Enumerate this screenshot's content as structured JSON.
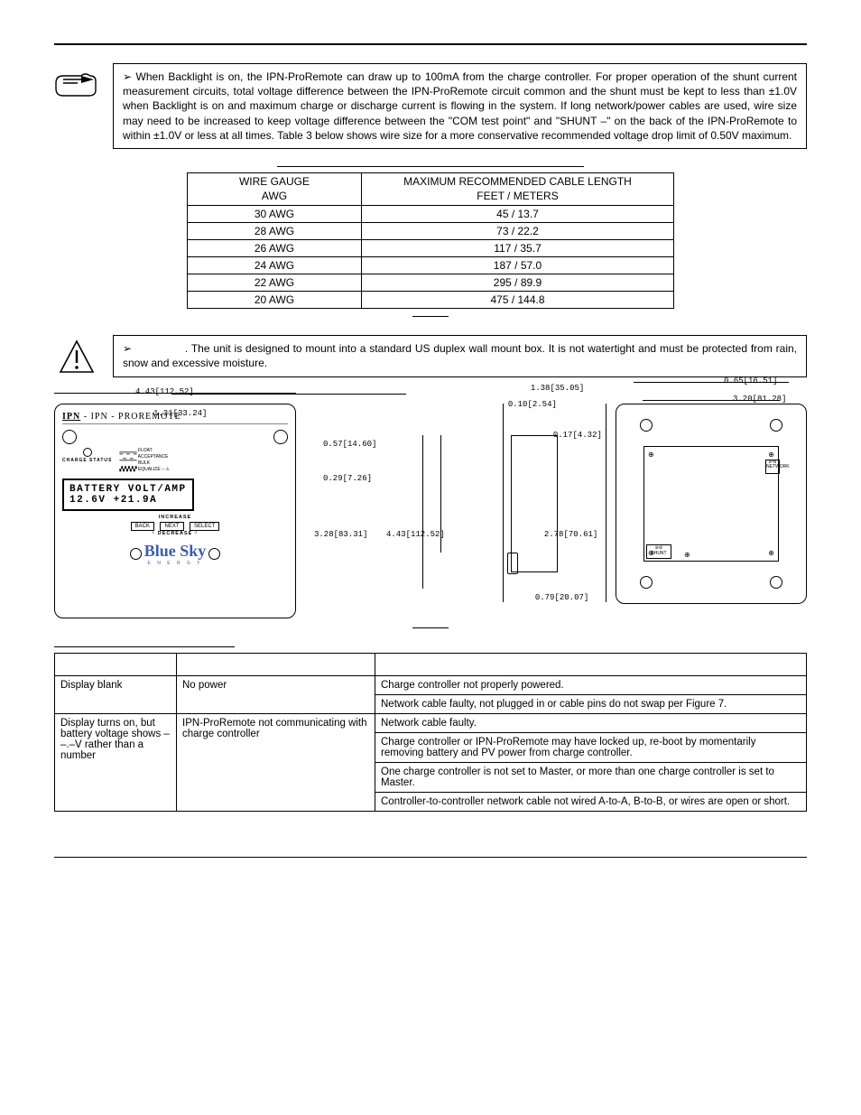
{
  "note1": {
    "text": "When Backlight is on, the IPN-ProRemote can draw up to 100mA from the charge controller. For proper operation of the shunt current measurement circuits, total voltage difference between the IPN-ProRemote circuit common and the shunt must be kept to less than ±1.0V when Backlight is on and maximum charge or discharge current is flowing in the system. If long network/power cables are used, wire size may need to be increased to keep voltage difference between the \"COM test point\" and \"SHUNT –\" on the back of the IPN-ProRemote to within ±1.0V or less at all times. Table 3 below shows wire size for a more conservative recommended voltage drop limit of 0.50V maximum."
  },
  "table3": {
    "header_col1_l1": "WIRE GAUGE",
    "header_col1_l2": "AWG",
    "header_col2_l1": "MAXIMUM RECOMMENDED CABLE LENGTH",
    "header_col2_l2": "FEET / METERS",
    "rows": [
      {
        "gauge": "30 AWG",
        "length": "45 / 13.7"
      },
      {
        "gauge": "28 AWG",
        "length": "73 / 22.2"
      },
      {
        "gauge": "26 AWG",
        "length": "117 / 35.7"
      },
      {
        "gauge": "24 AWG",
        "length": "187 / 57.0"
      },
      {
        "gauge": "22 AWG",
        "length": "295 / 89.9"
      },
      {
        "gauge": "20 AWG",
        "length": "475 / 144.8"
      }
    ]
  },
  "note2": {
    "text": ". The unit is designed to mount into a standard US duplex wall mount box. It is not watertight and must be protected from rain, snow and excessive moisture."
  },
  "figure": {
    "front": {
      "width_dim": "4.43[112.52]",
      "inner_dim": "1.31[33.24]",
      "title": "IPN - PROREMOTE",
      "status_label": "CHARGE\nSTATUS",
      "mode_float": "FLOAT",
      "mode_accept": "ACCEPTANCE",
      "mode_bulk": "BULK",
      "mode_eq": "EQUALIZE",
      "lcd_l1": "BATTERY  VOLT/AMP",
      "lcd_l2": "12.6V      +21.9A",
      "btn_increase": "INCREASE",
      "btn_back": "BACK",
      "btn_next": "NEXT",
      "btn_select": "SELECT",
      "btn_decrease": "DECREASE",
      "logo": "Blue Sky",
      "logo_sub": "E N E R G Y"
    },
    "mid": {
      "d1": "0.57[14.60]",
      "d2": "0.29[7.26]",
      "d3": "3.28[83.31]",
      "d4": "4.43[112.52]"
    },
    "side": {
      "d1": "1.38[35.05]",
      "d2": "0.10[2.54]",
      "d3": "0.17[4.32]",
      "d4": "2.78[70.61]",
      "d5": "0.79[20.07]"
    },
    "back": {
      "d1": "0.65[16.51]",
      "d2": "3.20[81.28]",
      "label_ipn": "IPN\nNETWORK",
      "label_shunt": "SHUNT"
    }
  },
  "trouble": {
    "rows": [
      {
        "symptom": "Display blank",
        "cause": "No power",
        "corrections": [
          "Charge controller not properly powered.",
          "Network cable faulty, not plugged in or cable pins do not swap per Figure 7."
        ]
      },
      {
        "symptom": "Display turns on, but battery voltage shows – –.–V rather than a number",
        "cause": "IPN-ProRemote not communicating with charge controller",
        "corrections": [
          "Network cable faulty.",
          "Charge controller or IPN-ProRemote may have locked up, re-boot by momentarily removing battery and PV power from charge controller.",
          "One charge controller is not set to Master, or more than one charge controller is set to Master.",
          "Controller-to-controller network cable not wired A-to-A, B-to-B, or wires are open or short."
        ]
      }
    ]
  }
}
